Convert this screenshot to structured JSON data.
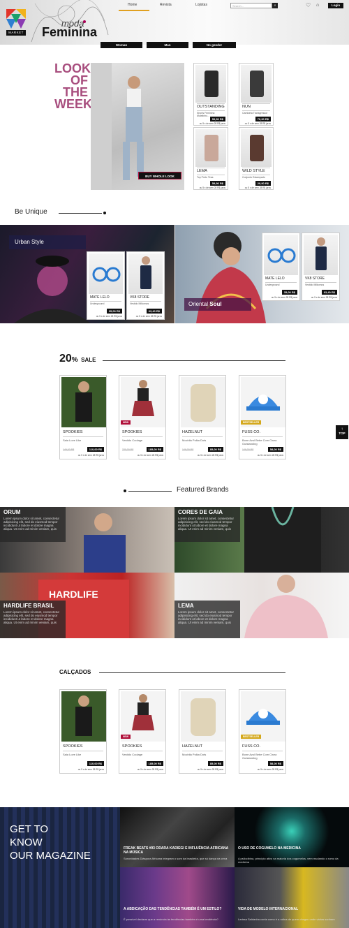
{
  "header": {
    "logo_text": "MARKET",
    "brand_small": "moda",
    "brand_big": "Feminina",
    "nav": [
      "Home",
      "Revista",
      "Lojistas"
    ],
    "search_placeholder": "Search...",
    "login": "Login",
    "gender_tabs": [
      "Woman",
      "Man",
      "No gender"
    ]
  },
  "look": {
    "title_lines": [
      "LOOK",
      "OF",
      "THE",
      "WEEK"
    ],
    "buy_label": "BUY WHOLE LOOK",
    "products": [
      {
        "title": "OUTSTANDING",
        "desc": "Shorts Feminino Moletinho...",
        "price": "59,90 R$",
        "inst": "ou 5 x de sem 28 R$ juros"
      },
      {
        "title": "NUN",
        "desc": "Camiseta Transgressor",
        "price": "79,90 R$",
        "inst": "ou 5 x de sem 28 R$ juros"
      },
      {
        "title": "LEMA",
        "desc": "Top Preto Tiras",
        "price": "59,90 R$",
        "inst": "ou 5 x de sem 28 R$ juros"
      },
      {
        "title": "WILD STYLE",
        "desc": "Conjunto Estampado",
        "price": "29,90 R$",
        "inst": "ou 5 x de sem 28 R$ juros"
      }
    ]
  },
  "unique": {
    "heading": "Be Unique",
    "urban": {
      "label": "Urban Style",
      "cards": [
        {
          "title": "MATE LELO",
          "desc": "Underground",
          "price": "35,00 R$",
          "inst": "ou 5 x de sem 28 R$ juros"
        },
        {
          "title": "VK8 STORE",
          "desc": "Vestido Milkomos",
          "price": "63,40 R$",
          "inst": "ou 5 x de sem 28 R$ juros"
        }
      ]
    },
    "oriental": {
      "label_a": "Oriental",
      "label_b": "Soul",
      "cards": [
        {
          "title": "MATE LELO",
          "desc": "Underground",
          "price": "35,00 R$",
          "inst": "ou 5 x de sem 28 R$ juros"
        },
        {
          "title": "VK8 STORE",
          "desc": "Vestido Milkomos",
          "price": "63,40 R$",
          "inst": "ou 5 x de sem 28 R$ juros"
        }
      ]
    }
  },
  "sale": {
    "heading_big": "20",
    "heading_pct": "%",
    "heading_rest": "SALE",
    "products": [
      {
        "title": "SPOOKIES",
        "desc": "Saia Love Like",
        "old": "149,00 R$",
        "price": "110,00 R$",
        "inst": "ou 5 x de sem 28 R$ juros",
        "badge": ""
      },
      {
        "title": "SPOOKIES",
        "desc": "Vestido Coolage",
        "old": "220,00 R$",
        "price": "185,00 R$",
        "inst": "ou 5 x de sem 28 R$ juros",
        "badge": "NEW"
      },
      {
        "title": "HAZELNUT",
        "desc": "Mochila Polka Dots",
        "old": "149,00 R$",
        "price": "85,00 R$",
        "inst": "ou 5 x de sem 28 R$ juros",
        "badge": ""
      },
      {
        "title": "FUSS CO.",
        "desc": "Bone Azul Bebe Com Cinza Outstanding",
        "old": "149,00 R$",
        "price": "58,00 R$",
        "inst": "ou 5 x de sem 28 R$ juros",
        "badge": "BESTSELLER"
      }
    ]
  },
  "top_label": "TOP",
  "brands": {
    "heading": "Featured Brands",
    "lorem": "Lorem ipsum dolor sit amet, consectetur adipisicing elit, sed do eiusmod tempor incididunt ut labore et dolore magna aliqua. Ut enim ad minim veniam, quis",
    "items": [
      "ORUM",
      "CORES DE GAIA",
      "HARDLIFE BRASIL",
      "LEMA"
    ]
  },
  "calcados": {
    "heading": "CALÇADOS",
    "products": [
      {
        "title": "SPOOKIES",
        "desc": "Saia Love Like",
        "price": "110,00 R$",
        "inst": "ou 5 x de sem 28 R$ juros",
        "badge": ""
      },
      {
        "title": "SPOOKIES",
        "desc": "Vestido Coolage",
        "price": "185,00 R$",
        "inst": "ou 5 x de sem 28 R$ juros",
        "badge": "NEW"
      },
      {
        "title": "HAZELNUT",
        "desc": "Mochila Polka Dots",
        "price": "85,00 R$",
        "inst": "ou 5 x de sem 28 R$ juros",
        "badge": ""
      },
      {
        "title": "FUSS CO.",
        "desc": "Bone Azul Bebe Com Cinza Outstanding",
        "price": "58,00 R$",
        "inst": "ou 5 x de sem 28 R$ juros",
        "badge": "BESTSELLER"
      }
    ]
  },
  "magazine": {
    "heading_lines": [
      "GET TO",
      "KNOW",
      "OUR MAGAZINE"
    ],
    "articles": [
      {
        "title": "FREAK BEATS #93 ODARA KADIEGI E INFLUÊNCIA AFRICANA NA MÚSICA",
        "desc": "Sonoridades Diáspora Africana integram o som da brasileira, que só dança na cena"
      },
      {
        "title": "O USO DE COGUMELO NA MEDICINA",
        "desc": "A psilocibina, princípio ativo na maioria dos cogumelos, vem mudando o rumo da medicina"
      },
      {
        "title": "A ABDICAÇÃO DAS TENDÊNCIAS TAMBÉM É UM ESTILO?",
        "desc": "É possível declarar que a renúncia às tendências também é uma tendência?"
      },
      {
        "title": "VIDA DE MODELO INTERNACIONAL",
        "desc": "Larissa Saldanha conta como é a rotina de quem chegou onde várias sonham"
      }
    ]
  },
  "colors": {
    "accent": "#e0a020",
    "lotw": "#a84e7e",
    "badge_new": "#b0103a",
    "badge_best": "#d4a81c"
  }
}
